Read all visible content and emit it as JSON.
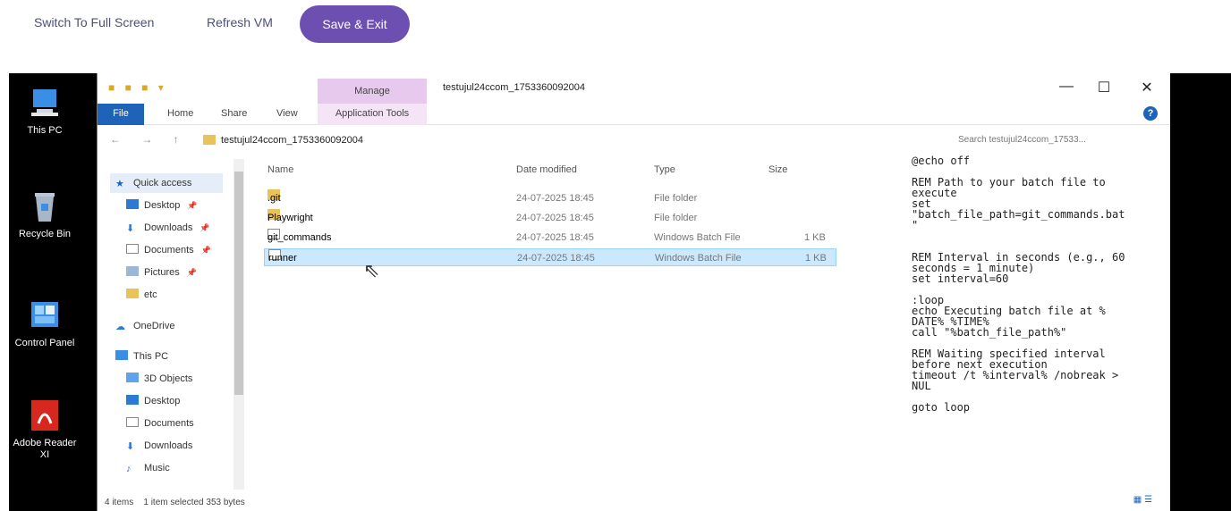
{
  "toolbar": {
    "switch_full": "Switch To Full Screen",
    "refresh": "Refresh VM",
    "save_exit": "Save & Exit"
  },
  "desktop": {
    "icons": [
      {
        "label": "This PC"
      },
      {
        "label": "Recycle Bin"
      },
      {
        "label": "Control Panel"
      },
      {
        "label": "Adobe Reader XI"
      }
    ]
  },
  "window": {
    "manage_tab": "Manage",
    "title": "testujul24ccom_1753360092004",
    "tabs": [
      "File",
      "Home",
      "Share",
      "View"
    ],
    "app_tools": "Application Tools",
    "address": "testujul24ccom_1753360092004",
    "search_placeholder": "Search testujul24ccom_17533...",
    "minimize": "—",
    "maximize": "☐",
    "close": "✕"
  },
  "nav": {
    "items": [
      {
        "label": "Quick access"
      },
      {
        "label": "Desktop"
      },
      {
        "label": "Downloads"
      },
      {
        "label": "Documents"
      },
      {
        "label": "Pictures"
      },
      {
        "label": "etc"
      },
      {
        "label": "OneDrive"
      },
      {
        "label": "This PC"
      },
      {
        "label": "3D Objects"
      },
      {
        "label": "Desktop"
      },
      {
        "label": "Documents"
      },
      {
        "label": "Downloads"
      },
      {
        "label": "Music"
      }
    ]
  },
  "files": {
    "headers": {
      "name": "Name",
      "date": "Date modified",
      "type": "Type",
      "size": "Size"
    },
    "rows": [
      {
        "name": ".git",
        "date": "24-07-2025 18:45",
        "type": "File folder",
        "size": ""
      },
      {
        "name": "Playwright",
        "date": "24-07-2025 18:45",
        "type": "File folder",
        "size": ""
      },
      {
        "name": "git_commands",
        "date": "24-07-2025 18:45",
        "type": "Windows Batch File",
        "size": "1 KB"
      },
      {
        "name": "runner",
        "date": "24-07-2025 18:45",
        "type": "Windows Batch File",
        "size": "1 KB"
      }
    ]
  },
  "code": {
    "text": "@echo off\n\nREM Path to your batch file to\nexecute\nset\n\"batch_file_path=git_commands.bat\n\"\n\n\nREM Interval in seconds (e.g., 60\nseconds = 1 minute)\nset interval=60\n\n:loop\necho Executing batch file at %\nDATE% %TIME%\ncall \"%batch_file_path%\"\n\nREM Waiting specified interval\nbefore next execution\ntimeout /t %interval% /nobreak >\nNUL\n\ngoto loop"
  },
  "status": {
    "items": "4 items",
    "selected": "1 item selected  353 bytes"
  }
}
